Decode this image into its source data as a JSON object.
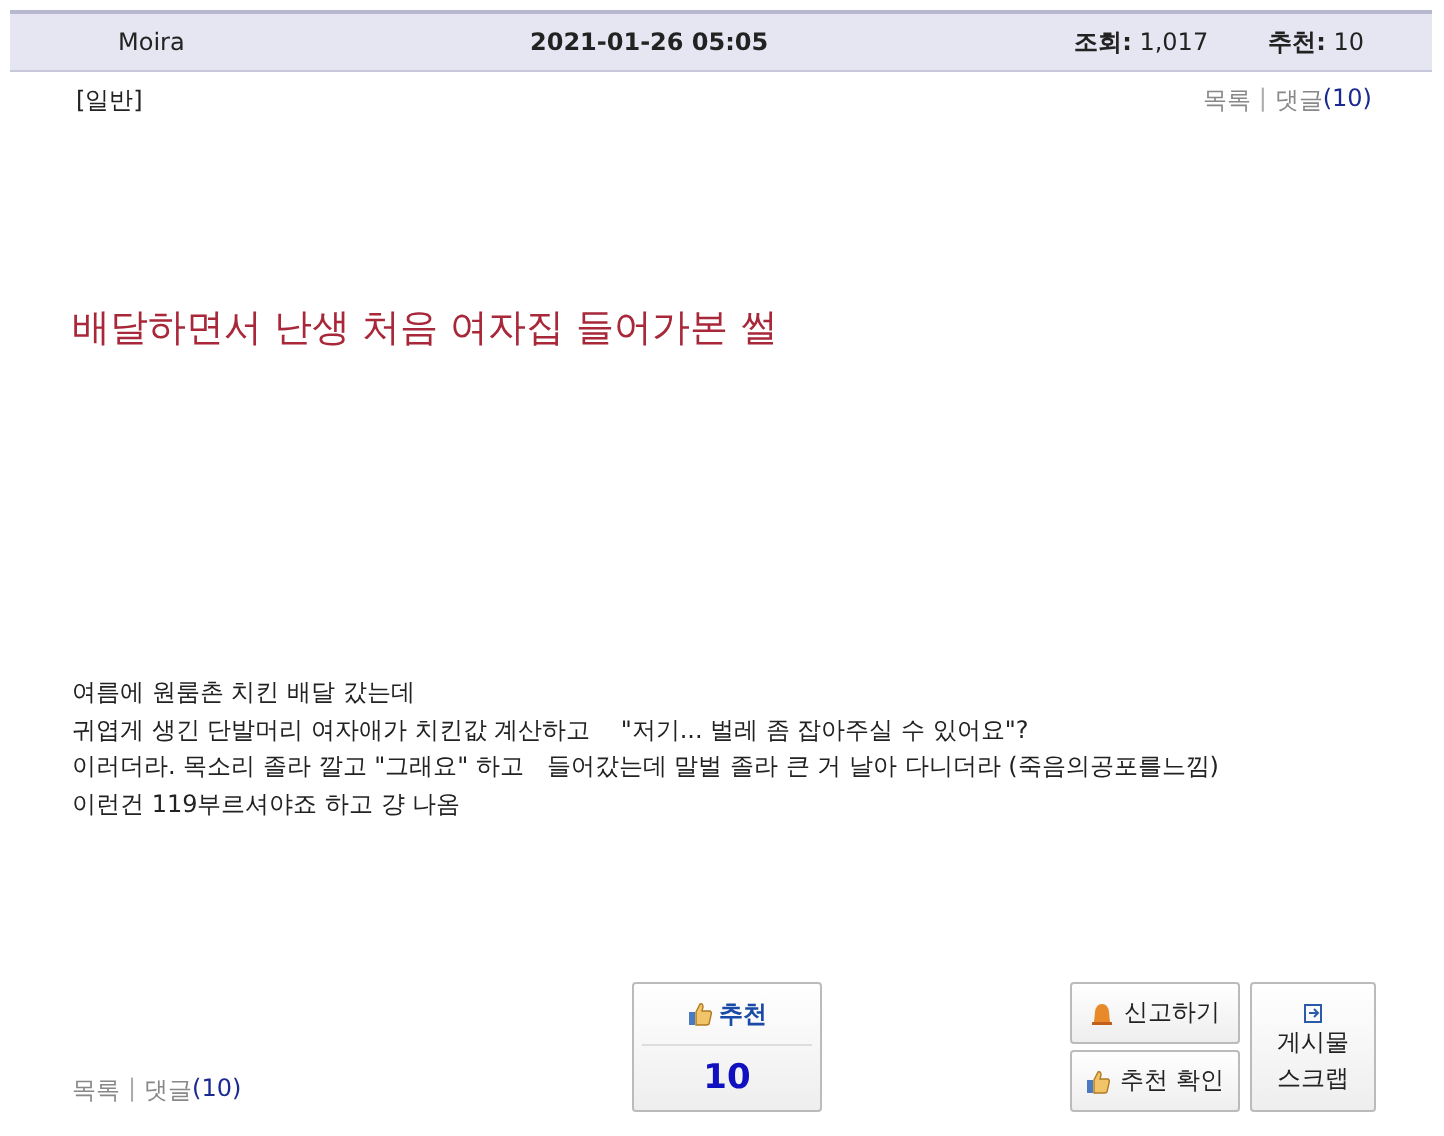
{
  "header": {
    "author": "Moira",
    "datetime": "2021-01-26 05:05",
    "views_label": "조회:",
    "views": "1,017",
    "recommend_label": "추천:",
    "recommend": "10"
  },
  "category": "[일반]",
  "top_links": {
    "list": "목록",
    "separator": "|",
    "comments": "댓글",
    "comment_count": "(10)"
  },
  "title": "배달하면서 난생 처음 여자집 들어가본 썰",
  "body": [
    "여름에 원룸촌 치킨 배달 갔는데",
    "귀엽게 생긴 단발머리 여자애가 치킨값 계산하고    \"저기... 벌레 좀 잡아주실 수 있어요\"?",
    "이러더라. 목소리 졸라 깔고 \"그래요\" 하고   들어갔는데 말벌 졸라 큰 거 날아 다니더라 (죽음의공포를느낌)",
    "이런건 119부르셔야죠 하고 걍 나옴"
  ],
  "recommend_box": {
    "label": "추천",
    "count": "10"
  },
  "report_button": "신고하기",
  "check_button": "추천 확인",
  "scrap_button": [
    "게시물",
    "스크랩"
  ],
  "bottom_links": {
    "list": "목록",
    "separator": "|",
    "comments": "댓글",
    "comment_count": "(10)"
  }
}
